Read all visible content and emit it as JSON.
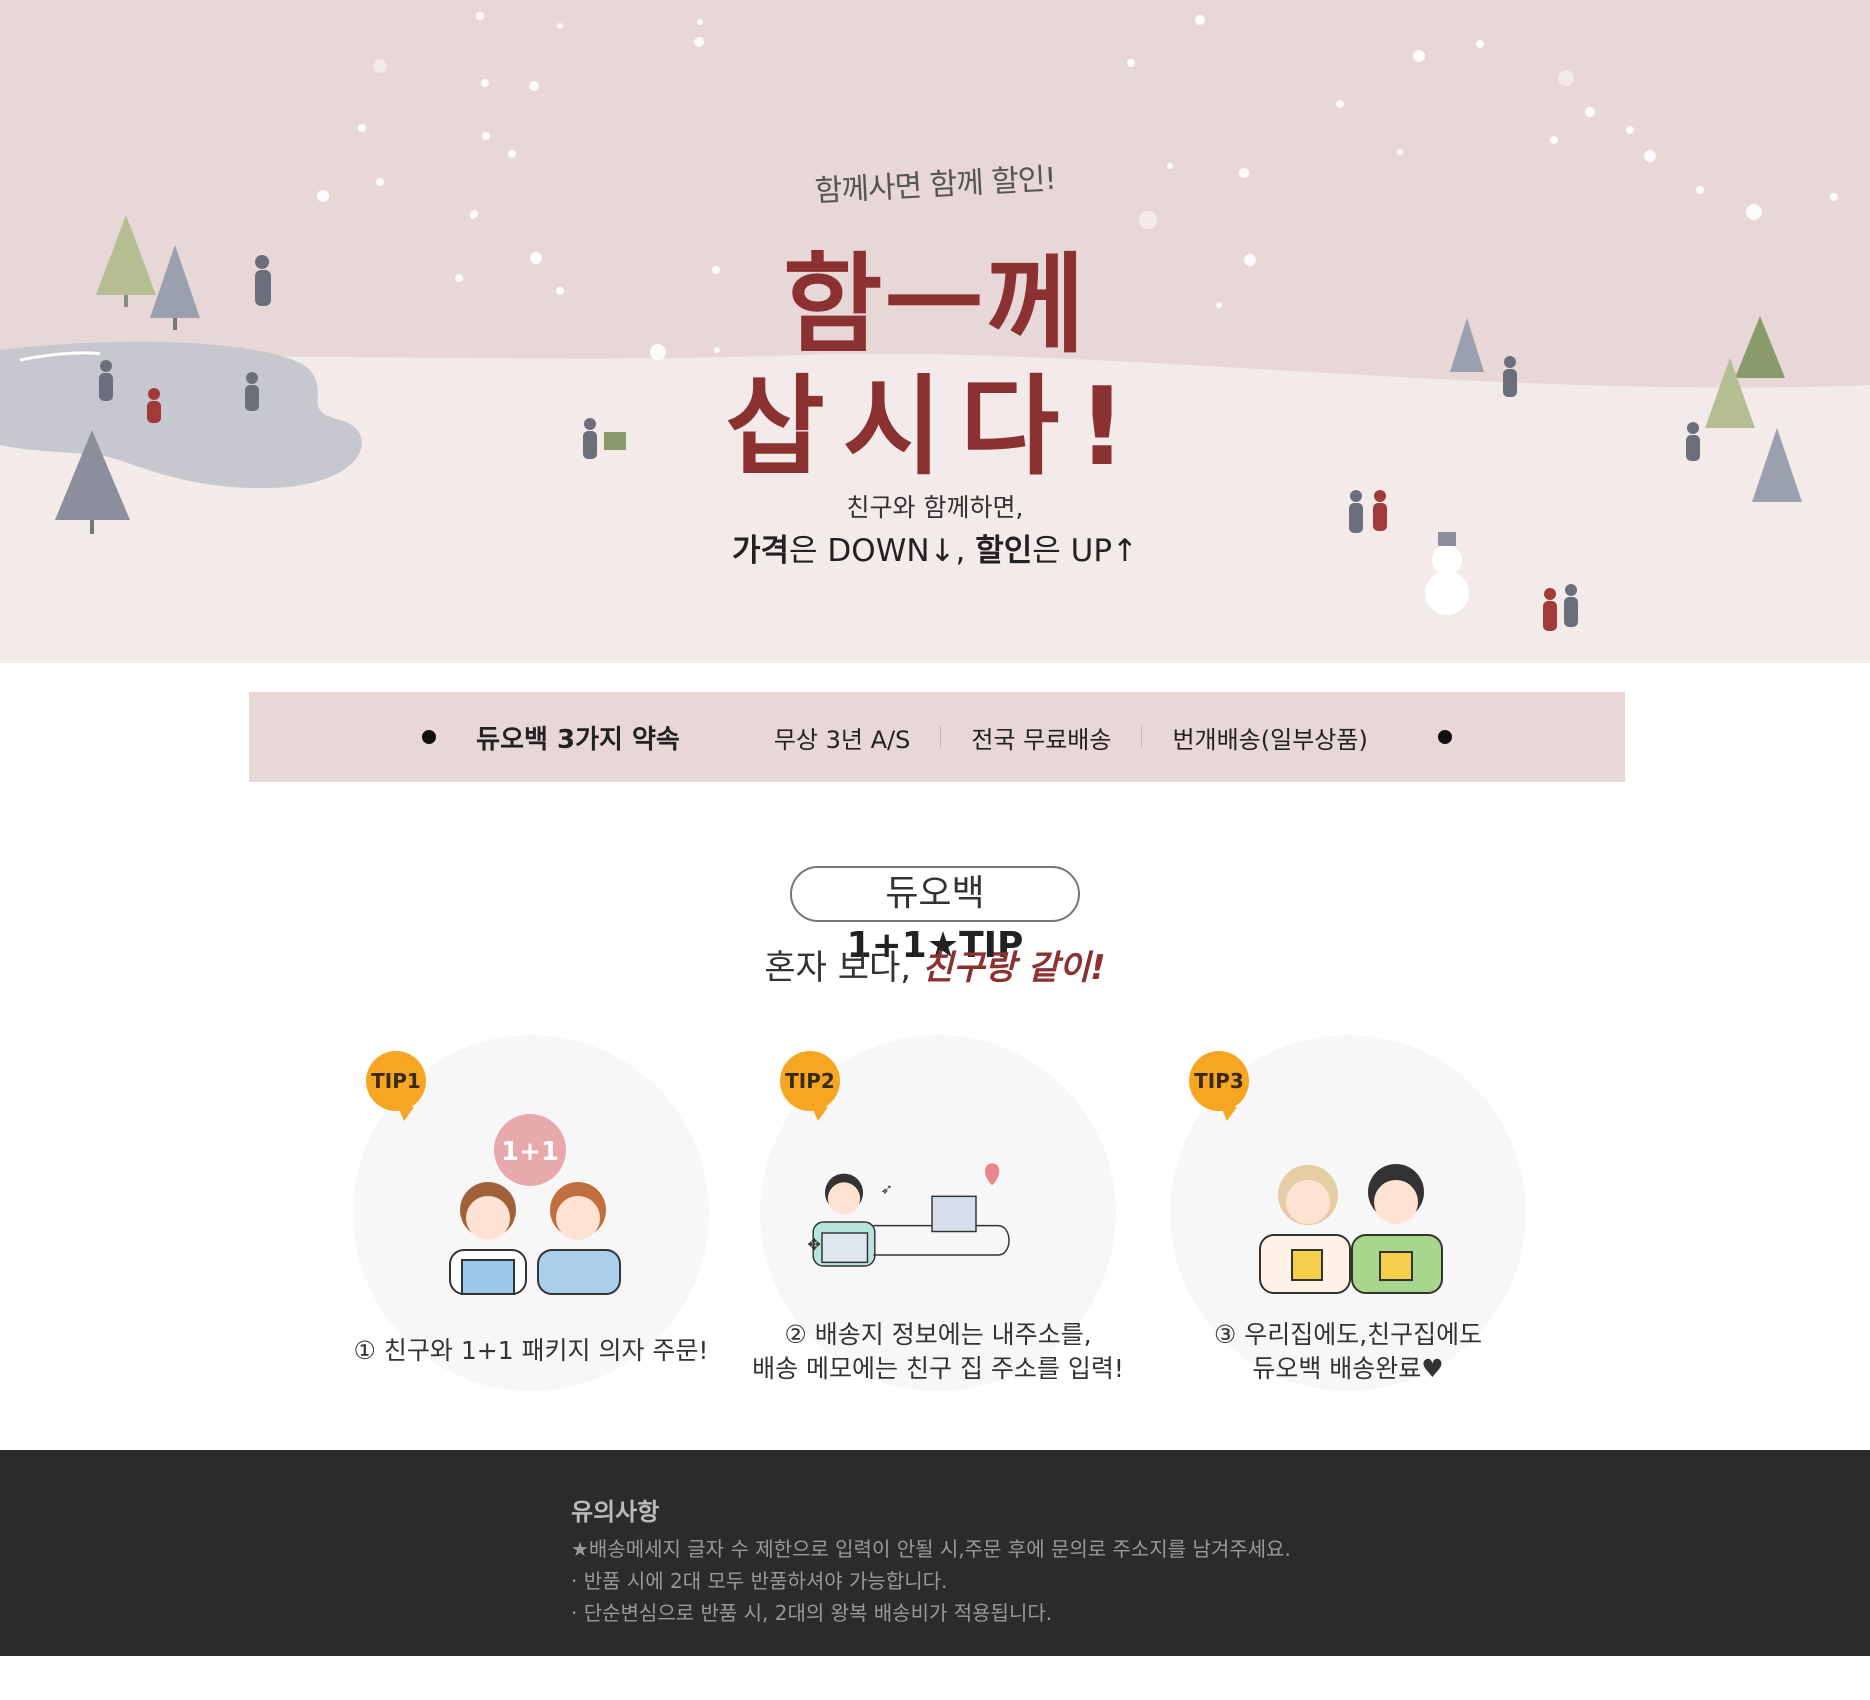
{
  "hero": {
    "kicker": "함께사면 함께 할인!",
    "title_line1": "함ㅡ께",
    "title_line2": "삽시다!",
    "sub_line1": "친구와 함께하면,",
    "sub_price_bold": "가격",
    "sub_price_rest": "은 DOWN↓, ",
    "sub_discount_bold": "할인",
    "sub_discount_rest": "은 UP↑"
  },
  "promise": {
    "title": "듀오백 3가지 약속",
    "items": [
      "무상 3년 A/S",
      "전국 무료배송",
      "번개배송(일부상품)"
    ]
  },
  "tip": {
    "pill_light": "듀오백 ",
    "pill_bold": "1+1★TIP",
    "sub_plain": "혼자 보다, ",
    "sub_bold": "친구랑 같이!",
    "cards": [
      {
        "badge": "TIP1",
        "bubble": "1+1",
        "caption_l1": "① 친구와 1+1 패키지 의자 주문!",
        "caption_l2": ""
      },
      {
        "badge": "TIP2",
        "caption_l1": "② 배송지 정보에는 내주소를,",
        "caption_l2": "배송 메모에는 친구 집 주소를 입력!"
      },
      {
        "badge": "TIP3",
        "caption_l1": "③ 우리집에도,친구집에도",
        "caption_l2": "듀오백 배송완료♥"
      }
    ]
  },
  "notice": {
    "heading": "유의사항",
    "lines": [
      "★배송메세지 글자 수 제한으로 입력이 안될 시,주문 후에 문의로 주소지를 남겨주세요.",
      "· 반품 시에 2대 모두 반품하셔야 가능합니다.",
      "· 단순변심으로 반품 시, 2대의 왕복 배송비가 적용됩니다."
    ]
  },
  "colors": {
    "hero_bg": "#e7d7d7",
    "snow_ground": "#f2e8e8",
    "title_red": "#8c3131",
    "badge_orange": "#f6a623",
    "notice_bg": "#2b2b2b"
  }
}
